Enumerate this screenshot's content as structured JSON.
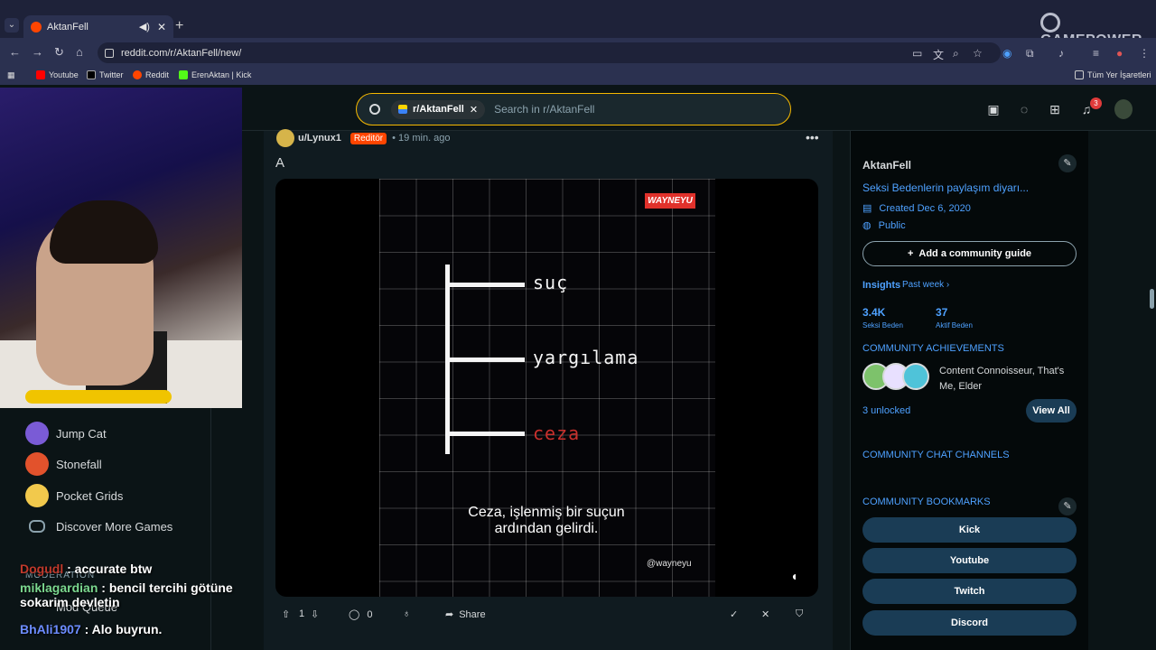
{
  "browser": {
    "tab_title": "AktanFell",
    "url": "reddit.com/r/AktanFell/new/",
    "bookmarks": [
      "Youtube",
      "Twitter",
      "Reddit",
      "ErenAktan | Kick"
    ],
    "all_bookmarks": "Tüm Yer İşaretleri",
    "brand": "GAMEPOWER"
  },
  "header": {
    "chip": "r/AktanFell",
    "search_placeholder": "Search in r/AktanFell",
    "notif_count": "3"
  },
  "games": [
    {
      "label": "Jump Cat",
      "color": "#7a5bd6"
    },
    {
      "label": "Stonefall",
      "color": "#e2522c"
    },
    {
      "label": "Pocket Grids",
      "color": "#f2c94c"
    },
    {
      "label": "Discover More Games",
      "color": "#8ba2ad"
    }
  ],
  "moderation": {
    "label": "MODERATION",
    "mod_queue": "Mod Queue"
  },
  "chat": [
    {
      "user": "Dogudl",
      "msg": " : accurate btw",
      "color": "#c0392b"
    },
    {
      "user": "miklagardian",
      "msg": " : bencil tercihi götüne sokarim devletin",
      "color": "#7bd88f"
    },
    {
      "user": "BhAli1907",
      "msg": " : Alo buyrun.",
      "color": "#6c8cff"
    }
  ],
  "post": {
    "user": "u/Lynux1",
    "flair": "Reditör",
    "time": "• 19 min. ago",
    "title": "A",
    "video": {
      "watermark": "WAYNEYU",
      "labels": [
        "suç",
        "yargılama",
        "ceza"
      ],
      "subtitle_line1": "Ceza, işlenmiş bir suçun",
      "subtitle_line2": "ardından gelirdi.",
      "handle": "@wayneyu"
    },
    "votes": "1",
    "comments": "0",
    "share": "Share"
  },
  "community": {
    "name": "AktanFell",
    "description": "Seksi Bedenlerin paylaşım diyarı...",
    "created": "Created Dec 6, 2020",
    "visibility": "Public",
    "guide_button": "Add a community guide",
    "insights": "Insights",
    "period": "Past week",
    "members_value": "3.4K",
    "members_label": "Seksi Beden",
    "active_value": "37",
    "active_label": "Aktif Beden",
    "achievements_title": "COMMUNITY ACHIEVEMENTS",
    "achievements_text": "Content Connoisseur, That's Me, Elder",
    "unlocked": "3 unlocked",
    "view_all": "View All",
    "chat_channels": "COMMUNITY CHAT CHANNELS",
    "bookmarks_title": "COMMUNITY BOOKMARKS",
    "bookmarks": [
      "Kick",
      "Youtube",
      "Twitch",
      "Discord"
    ]
  }
}
